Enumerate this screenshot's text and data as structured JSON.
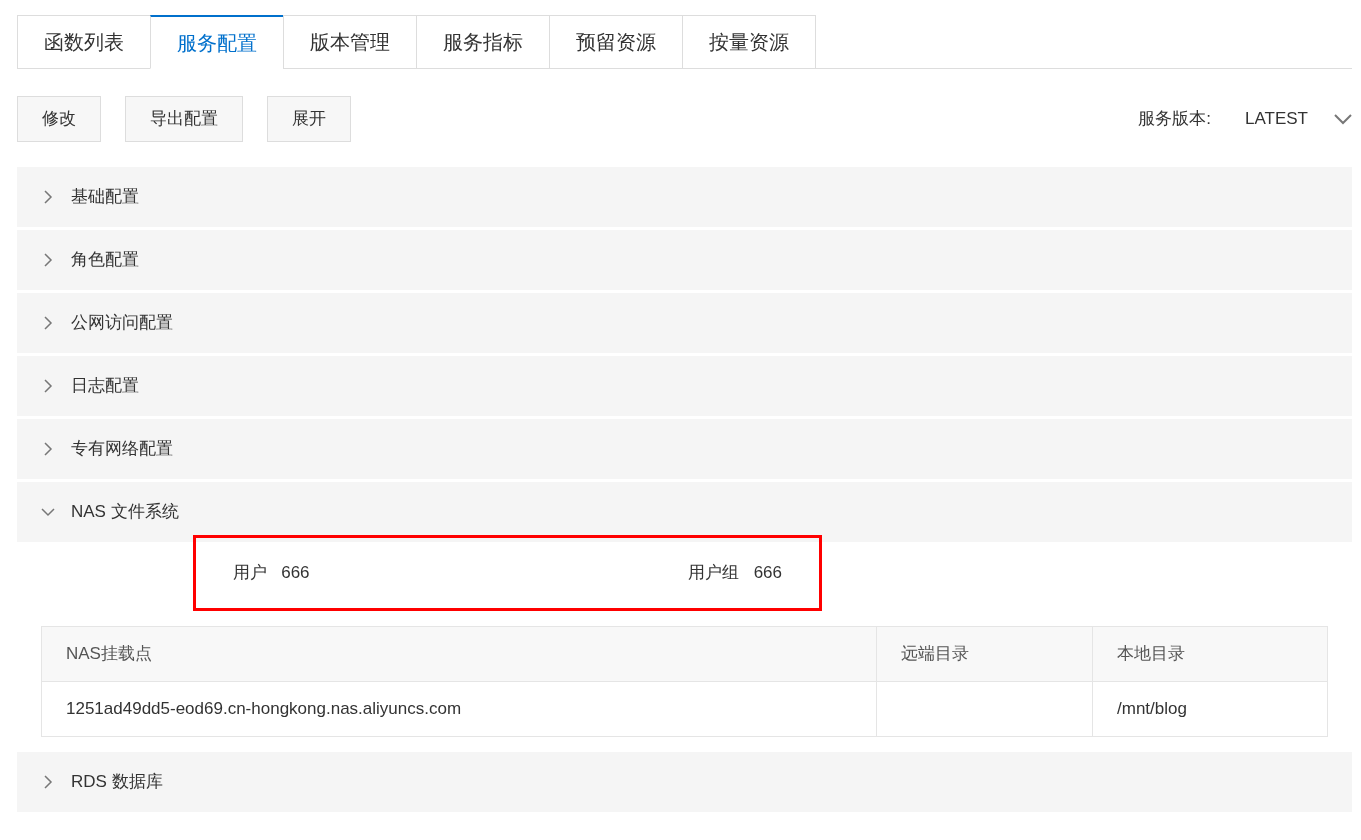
{
  "tabs": [
    {
      "label": "函数列表",
      "selected": false
    },
    {
      "label": "服务配置",
      "selected": true
    },
    {
      "label": "版本管理",
      "selected": false
    },
    {
      "label": "服务指标",
      "selected": false
    },
    {
      "label": "预留资源",
      "selected": false
    },
    {
      "label": "按量资源",
      "selected": false
    }
  ],
  "toolbar": {
    "buttons": [
      "修改",
      "导出配置",
      "展开"
    ],
    "version_label": "服务版本:",
    "version_value": "LATEST"
  },
  "sections": [
    {
      "title": "基础配置",
      "expanded": false
    },
    {
      "title": "角色配置",
      "expanded": false
    },
    {
      "title": "公网访问配置",
      "expanded": false
    },
    {
      "title": "日志配置",
      "expanded": false
    },
    {
      "title": "专有网络配置",
      "expanded": false
    },
    {
      "title": "NAS 文件系统",
      "expanded": true,
      "user_label": "用户",
      "user_value": "666",
      "group_label": "用户组",
      "group_value": "666",
      "table": {
        "columns": [
          "NAS挂载点",
          "远端目录",
          "本地目录"
        ],
        "rows": [
          [
            "1251ad49dd5-eod69.cn-hongkong.nas.aliyuncs.com",
            "",
            "/mnt/blog"
          ]
        ]
      }
    },
    {
      "title": "RDS 数据库",
      "expanded": false
    }
  ]
}
